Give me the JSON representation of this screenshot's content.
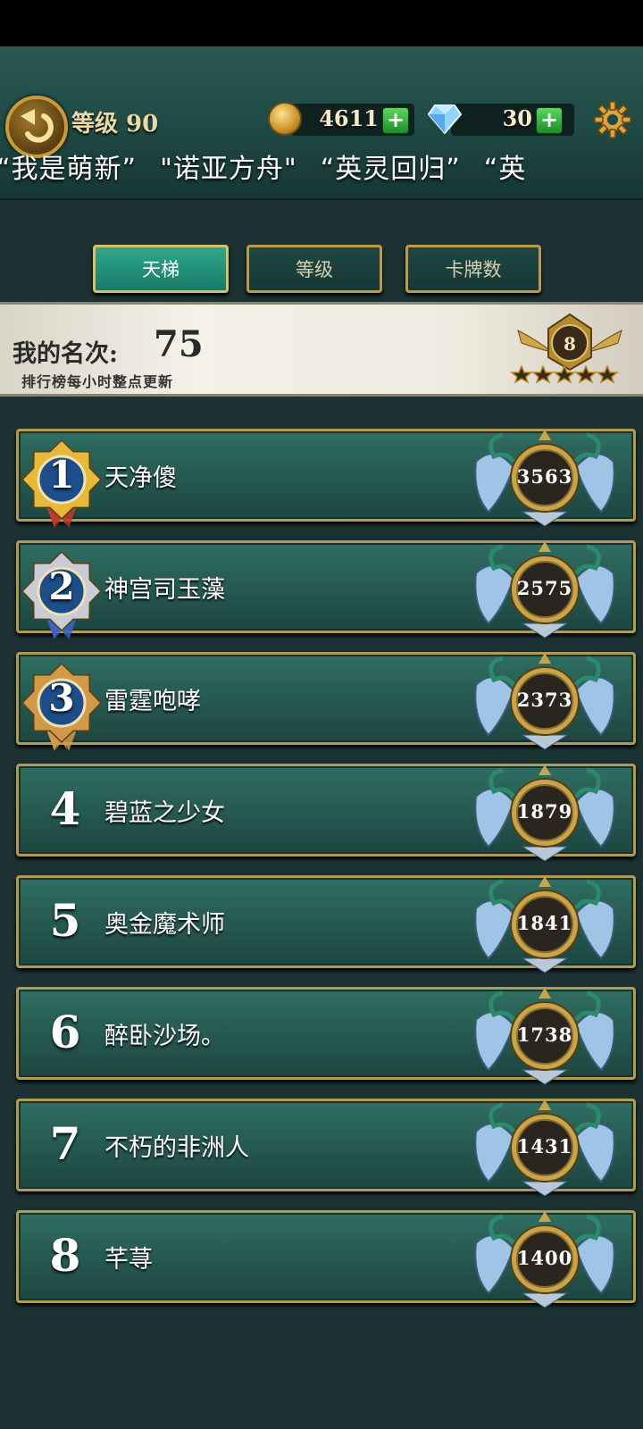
{
  "header": {
    "level_label": "等级 90",
    "coins": "4611",
    "gems": "30",
    "marquee": [
      "“我是萌新”",
      "\"诺亚方舟\"",
      "“英灵回归”",
      "“英"
    ]
  },
  "tabs": [
    {
      "label": "天梯",
      "active": true
    },
    {
      "label": "等级",
      "active": false
    },
    {
      "label": "卡牌数",
      "active": false
    }
  ],
  "my_rank": {
    "title": "我的名次:",
    "value": "75",
    "note": "排行榜每小时整点更新",
    "tier": "8"
  },
  "leaderboard": [
    {
      "rank": "1",
      "name": "天净傻",
      "score": "3563"
    },
    {
      "rank": "2",
      "name": "神宫司玉藻",
      "score": "2575"
    },
    {
      "rank": "3",
      "name": "雷霆咆哮",
      "score": "2373"
    },
    {
      "rank": "4",
      "name": "碧蓝之少女",
      "score": "1879"
    },
    {
      "rank": "5",
      "name": "奥金魔术师",
      "score": "1841"
    },
    {
      "rank": "6",
      "name": "醉卧沙场。",
      "score": "1738"
    },
    {
      "rank": "7",
      "name": "不朽的非洲人",
      "score": "1431"
    },
    {
      "rank": "8",
      "name": "芊荨",
      "score": "1400"
    }
  ],
  "colors": {
    "gold": "#c8a44a",
    "medal_gold": "#e7b93a",
    "medal_silver": "#c9ccd4",
    "medal_bronze": "#d09a4a",
    "ribbon_red": "#c0392b",
    "ribbon_blue": "#3a64c8"
  },
  "icons": {
    "back": "back-arrow-icon",
    "coin": "coin-icon",
    "gem": "diamond-icon",
    "settings": "gear-icon"
  }
}
